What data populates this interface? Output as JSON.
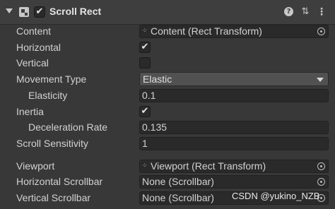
{
  "header": {
    "title": "Scroll Rect",
    "enabled": "✔",
    "help_glyph": "?",
    "preset_glyph": "⇅",
    "menu_glyph": "⋮"
  },
  "fields": {
    "content": {
      "label": "Content",
      "value": "Content (Rect Transform)",
      "glyph": "⁘"
    },
    "horizontal": {
      "label": "Horizontal",
      "checked": "✔"
    },
    "vertical": {
      "label": "Vertical",
      "checked": ""
    },
    "movement_type": {
      "label": "Movement Type",
      "value": "Elastic"
    },
    "elasticity": {
      "label": "Elasticity",
      "value": "0.1"
    },
    "inertia": {
      "label": "Inertia",
      "checked": "✔"
    },
    "deceleration_rate": {
      "label": "Deceleration Rate",
      "value": "0.135"
    },
    "scroll_sensitivity": {
      "label": "Scroll Sensitivity",
      "value": "1"
    },
    "viewport": {
      "label": "Viewport",
      "value": "Viewport (Rect Transform)",
      "glyph": "⁘"
    },
    "horizontal_scrollbar": {
      "label": "Horizontal Scrollbar",
      "value": "None (Scrollbar)"
    },
    "vertical_scrollbar": {
      "label": "Vertical Scrollbar",
      "value": "None (Scrollbar)"
    }
  },
  "watermark": "CSDN @yukino_NZB",
  "colors": {
    "background": "#383838",
    "field_bg": "#2a2a2a",
    "dropdown_bg": "#515151",
    "text": "#d2d2d2"
  }
}
